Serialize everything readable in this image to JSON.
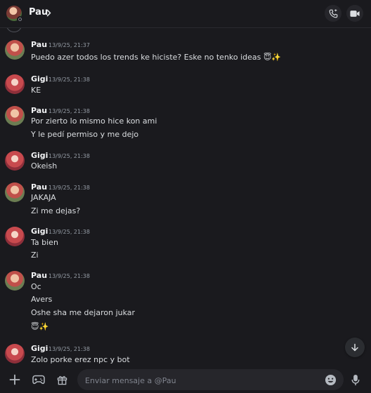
{
  "header": {
    "title": "Pau",
    "call_icon": "phone-icon",
    "video_icon": "video-camera-icon"
  },
  "messages": [
    {
      "author": "Pau",
      "time": "13/9/25, 21:37",
      "lines": [
        "Puedo azer todos los trends ke hiciste? Eske no tenko ideas 😇✨"
      ]
    },
    {
      "author": "Gigi",
      "time": "13/9/25, 21:38",
      "lines": [
        "KE"
      ]
    },
    {
      "author": "Pau",
      "time": "13/9/25, 21:38",
      "lines": [
        "Por zierto lo mismo hice kon ami",
        "Y le pedí permiso y me dejo"
      ]
    },
    {
      "author": "Gigi",
      "time": "13/9/25, 21:38",
      "lines": [
        "Okeish"
      ]
    },
    {
      "author": "Pau",
      "time": "13/9/25, 21:38",
      "lines": [
        "JAKAJA",
        "Zi me dejas?"
      ]
    },
    {
      "author": "Gigi",
      "time": "13/9/25, 21:38",
      "lines": [
        "Ta bien",
        "Zi"
      ]
    },
    {
      "author": "Pau",
      "time": "13/9/25, 21:38",
      "lines": [
        "Oc",
        "Avers",
        "Oshe sha me dejaron jukar",
        "😇✨"
      ]
    },
    {
      "author": "Gigi",
      "time": "13/9/25, 21:38",
      "lines": [
        "Zolo porke erez npc y bot"
      ]
    }
  ],
  "composer": {
    "placeholder": "Enviar mensaje a @Pau",
    "value": ""
  },
  "colors": {
    "background": "#1a1a1e",
    "text": "#dbdee1",
    "muted": "#949ba4",
    "input": "#26262b"
  }
}
